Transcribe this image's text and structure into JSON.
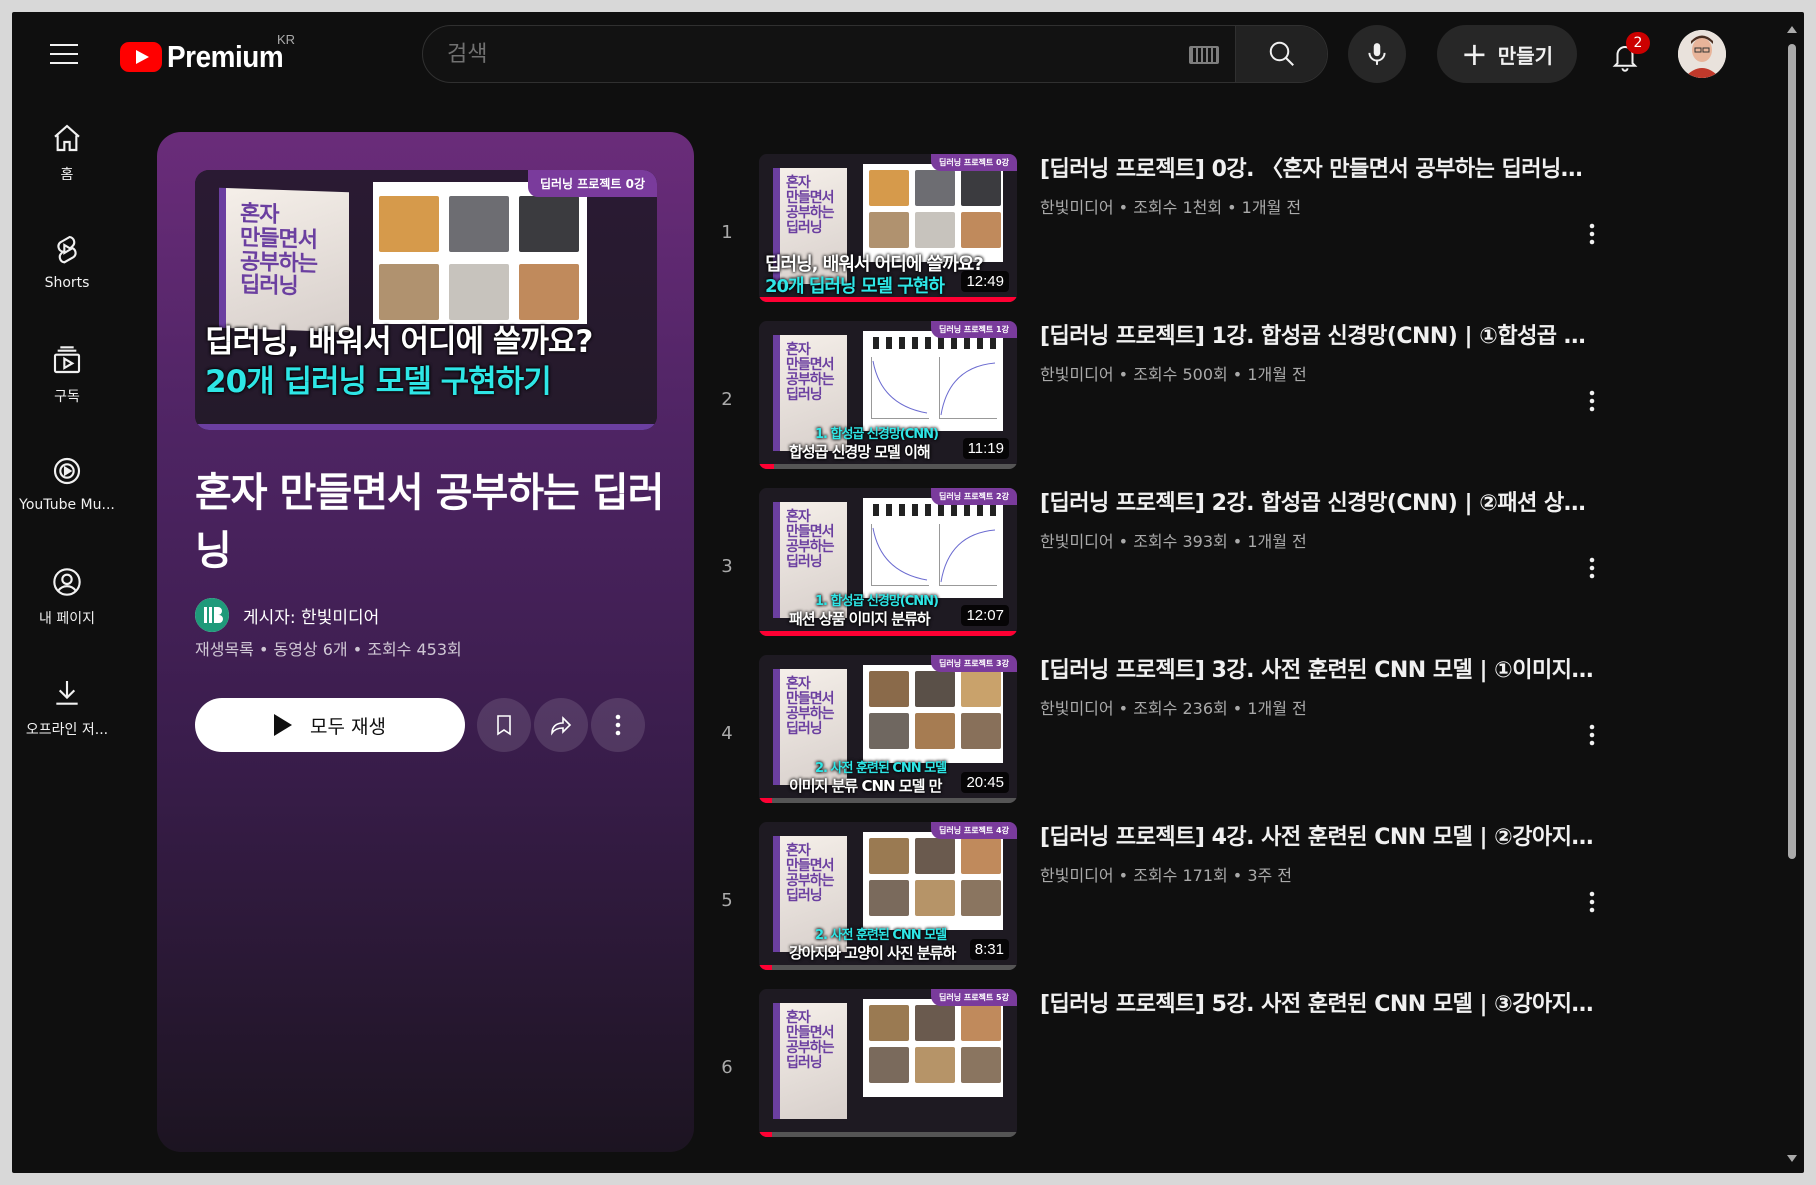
{
  "header": {
    "logo_text": "Premium",
    "region": "KR",
    "search_placeholder": "검색",
    "create_label": "만들기",
    "notification_count": "2"
  },
  "sidebar": {
    "items": [
      {
        "label": "홈",
        "icon": "home-icon"
      },
      {
        "label": "Shorts",
        "icon": "shorts-icon"
      },
      {
        "label": "구독",
        "icon": "subscriptions-icon"
      },
      {
        "label": "YouTube Mu...",
        "icon": "youtube-music-icon"
      },
      {
        "label": "내 페이지",
        "icon": "my-page-icon"
      },
      {
        "label": "오프라인 저...",
        "icon": "download-icon"
      }
    ]
  },
  "playlist": {
    "title": "혼자 만들면서 공부하는 딥러닝",
    "owner": "게시자: 한빛미디어",
    "meta": "재생목록 • 동영상 6개 • 조회수 453회",
    "play_all": "모두 재생",
    "thumb": {
      "tag": "딥러닝 프로젝트 0강",
      "book": "혼자\n만들면서\n공부하는\n딥러닝",
      "line1": "딥러닝, 배워서 어디에 쓸까요?",
      "line2": "20개 딥러닝 모델 구현하기"
    }
  },
  "videos": [
    {
      "index": "1",
      "title": "[딥러닝 프로젝트] 0강. 〈혼자 만들면서 공부하는 딥러닝〉 ...",
      "meta": "한빛미디어 • 조회수 1천회 • 1개월 전",
      "duration": "12:49",
      "tag": "딥러닝 프로젝트 0강",
      "cap_top": "딥러닝, 배워서 어디에 쓸까요?",
      "cap_bottom": "20개 딥러닝 모델 구현하",
      "progress": 1.0
    },
    {
      "index": "2",
      "title": "[딥러닝 프로젝트] 1강. 합성곱 신경망(CNN) | ①합성곱 신경...",
      "meta": "한빛미디어 • 조회수 500회 • 1개월 전",
      "duration": "11:19",
      "tag": "딥러닝 프로젝트 1강",
      "cap_top": "1. 합성곱 신경망(CNN)",
      "cap_bottom": "합성곱 신경망 모델 이해",
      "progress": 0.06
    },
    {
      "index": "3",
      "title": "[딥러닝 프로젝트] 2강. 합성곱 신경망(CNN) | ②패션 상품 이...",
      "meta": "한빛미디어 • 조회수 393회 • 1개월 전",
      "duration": "12:07",
      "tag": "딥러닝 프로젝트 2강",
      "cap_top": "1. 합성곱 신경망(CNN)",
      "cap_bottom": "패션 상품 이미지 분류하",
      "progress": 1.0
    },
    {
      "index": "4",
      "title": "[딥러닝 프로젝트] 3강. 사전 훈련된 CNN 모델 | ①이미지 분...",
      "meta": "한빛미디어 • 조회수 236회 • 1개월 전",
      "duration": "20:45",
      "tag": "딥러닝 프로젝트 3강",
      "cap_top": "2. 사전 훈련된 CNN 모델",
      "cap_bottom": "이미지 분류 CNN 모델 만",
      "progress": 0.05
    },
    {
      "index": "5",
      "title": "[딥러닝 프로젝트] 4강. 사전 훈련된 CNN 모델 | ②강아지와 ...",
      "meta": "한빛미디어 • 조회수 171회 • 3주 전",
      "duration": "8:31",
      "tag": "딥러닝 프로젝트 4강",
      "cap_top": "2. 사전 훈련된 CNN 모델",
      "cap_bottom": "강아지와 고양이 사진 분류하",
      "progress": 0.05
    },
    {
      "index": "6",
      "title": "[딥러닝 프로젝트] 5강. 사전 훈련된 CNN 모델 | ③강아지와 ...",
      "meta": "",
      "duration": "",
      "tag": "딥러닝 프로젝트 5강",
      "cap_top": "",
      "cap_bottom": "",
      "progress": 0.05
    }
  ]
}
